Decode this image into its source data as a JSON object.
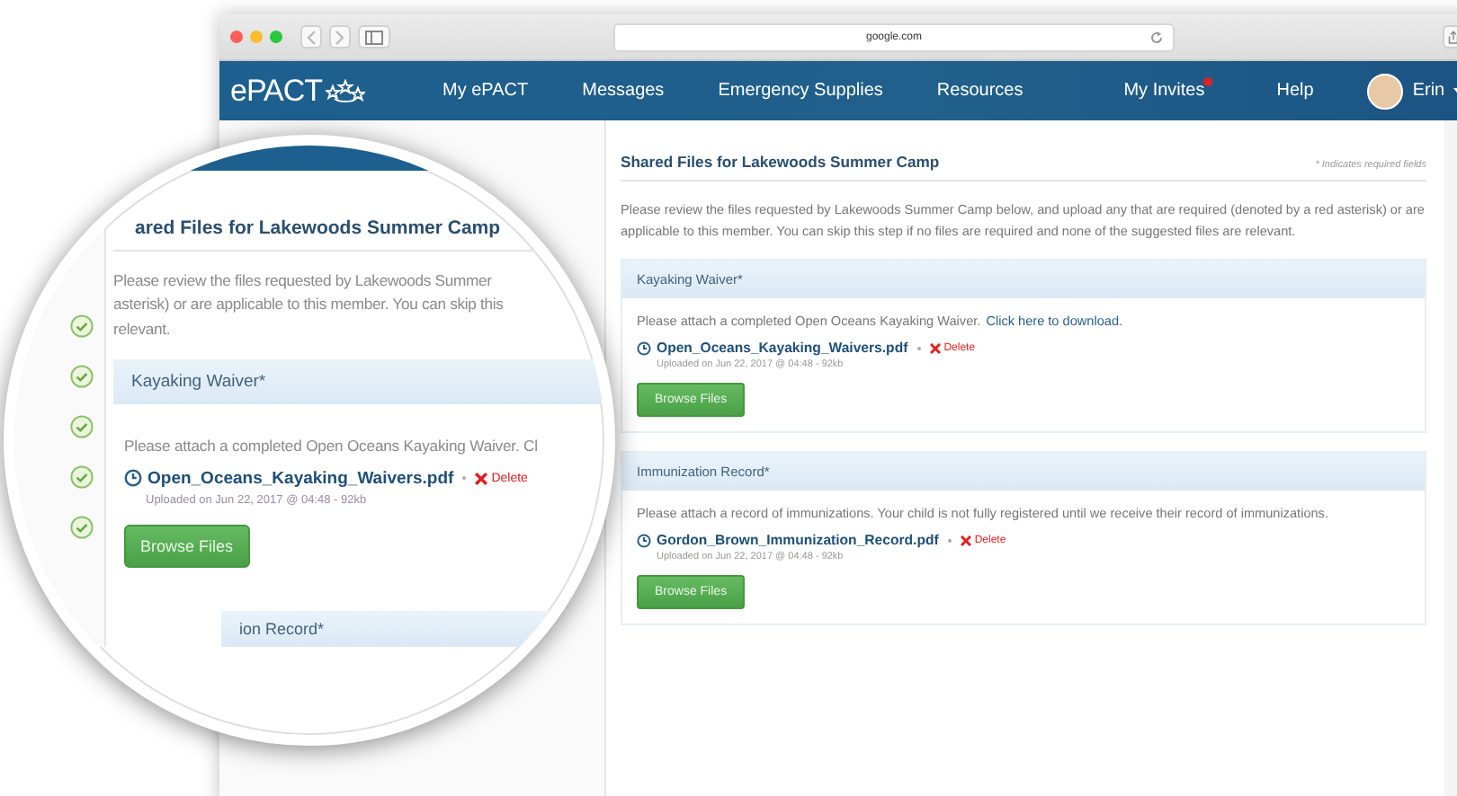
{
  "browser": {
    "address": "google.com"
  },
  "nav": {
    "logo": "ePACT",
    "items": [
      {
        "label": "My ePACT",
        "badge": false
      },
      {
        "label": "Messages",
        "badge": false
      },
      {
        "label": "Emergency Supplies",
        "badge": false
      },
      {
        "label": "Resources",
        "badge": false
      },
      {
        "label": "My Invites",
        "badge": true
      },
      {
        "label": "Help",
        "badge": false
      }
    ],
    "user": "Erin"
  },
  "page": {
    "title": "Shared Files for Lakewoods Summer Camp",
    "required_note": "* Indicates required fields",
    "intro": "Please review the files requested by Lakewoods Summer Camp below, and upload any that are required (denoted by a red asterisk) or are applicable to this member. You can skip this step if no files are required and none of the suggested files are relevant.",
    "sections": [
      {
        "title": "Kayaking Waiver*",
        "instruction": "Please attach a completed Open Oceans Kayaking Waiver.",
        "link": "Click here to download.",
        "file": "Open_Oceans_Kayaking_Waivers.pdf",
        "delete": "Delete",
        "meta": "Uploaded on Jun 22, 2017 @ 04:48 - 92kb",
        "button": "Browse Files"
      },
      {
        "title": "Immunization Record*",
        "instruction": "Please attach a record of immunizations. Your child is not fully registered until we receive their record of immunizations.",
        "file": "Gordon_Brown_Immunization_Record.pdf",
        "delete": "Delete",
        "meta": "Uploaded on Jun 22, 2017 @ 04:48 - 92kb",
        "button": "Browse Files"
      }
    ]
  },
  "magnifier": {
    "title": "ared Files for Lakewoods Summer Camp",
    "intro_lines": [
      "Please review the files requested by Lakewoods Summer",
      "asterisk) or are applicable to this member. You can skip this",
      "relevant."
    ],
    "steps": [
      {
        "done": true
      },
      {
        "done": true
      },
      {
        "done": true
      },
      {
        "done": true
      },
      {
        "done": true
      }
    ],
    "section": {
      "title": "Kayaking Waiver*",
      "instruction": "Please attach a completed Open Oceans Kayaking Waiver. Cl",
      "file": "Open_Oceans_Kayaking_Waivers.pdf",
      "delete": "Delete",
      "meta": "Uploaded on Jun 22, 2017 @ 04:48 - 92kb",
      "button": "Browse Files"
    },
    "next_section": "ion Record*"
  }
}
